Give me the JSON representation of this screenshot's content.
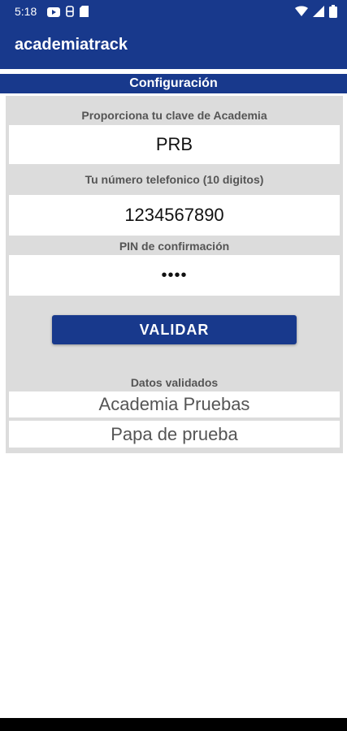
{
  "status_bar": {
    "time": "5:18"
  },
  "app_bar": {
    "title": "academiatrack"
  },
  "section": {
    "title": "Configuración"
  },
  "form": {
    "academy_label": "Proporciona tu clave de Academia",
    "academy_value": "PRB",
    "phone_label": "Tu número telefonico (10 digitos)",
    "phone_value": "1234567890",
    "pin_label": "PIN  de confirmación",
    "pin_value": "••••",
    "validate_label": "VALIDAR"
  },
  "validated": {
    "label": "Datos validados",
    "academy_name": "Academia Pruebas",
    "parent_name": "Papa de prueba"
  },
  "icons": {
    "status_left": [
      "youtube-icon",
      "sync-icon",
      "sim-icon"
    ],
    "status_right": [
      "wifi-icon",
      "signal-icon",
      "battery-icon"
    ]
  },
  "colors": {
    "primary": "#18398c",
    "panel": "#dcdcdc"
  }
}
